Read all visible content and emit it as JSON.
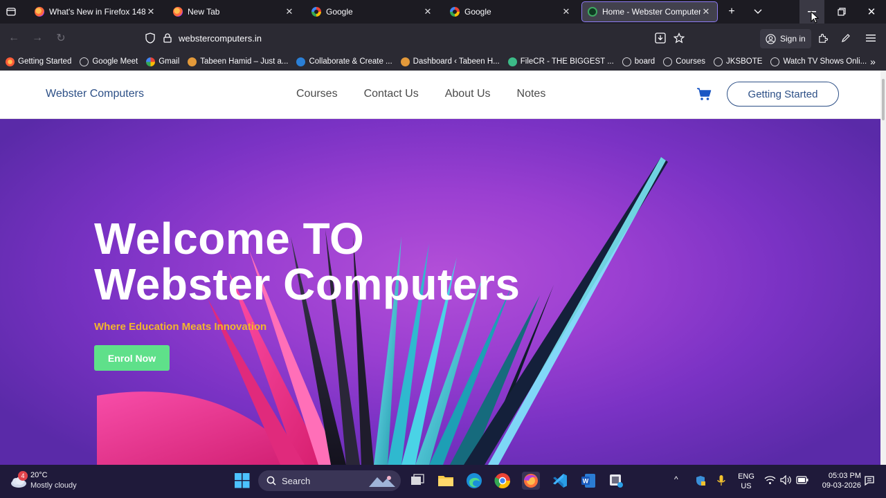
{
  "browser": {
    "tabs": [
      {
        "title": "What's New in Firefox 148",
        "favicon": "firefox-icon"
      },
      {
        "title": "New Tab",
        "favicon": "firefox-icon"
      },
      {
        "title": "Google",
        "favicon": "google-icon"
      },
      {
        "title": "Google",
        "favicon": "google-icon"
      },
      {
        "title": "Home - Webster Computers",
        "favicon": "site-icon",
        "active": true
      }
    ],
    "url": "webstercomputers.in",
    "sign_in_label": "Sign in",
    "bookmarks": [
      "Getting Started",
      "Google Meet",
      "Gmail",
      "Tabeen Hamid – Just a...",
      "Collaborate & Create ...",
      "Dashboard ‹ Tabeen H...",
      "FileCR - THE BIGGEST ...",
      "board",
      "Courses",
      "JKSBOTE",
      "Watch TV Shows Onli..."
    ]
  },
  "site": {
    "brand": "Webster Computers",
    "nav": [
      "Courses",
      "Contact Us",
      "About Us",
      "Notes"
    ],
    "cta_label": "Getting Started",
    "hero": {
      "title_line1": "Welcome TO",
      "title_line2": "Webster Computers",
      "subtitle": "Where Education Meats Innovation",
      "button_label": "Enrol Now"
    }
  },
  "taskbar": {
    "weather_temp": "20°C",
    "weather_desc": "Mostly cloudy",
    "weather_badge": "4",
    "search_label": "Search",
    "lang_top": "ENG",
    "lang_bottom": "US",
    "time": "05:03 PM",
    "date": "09-03-2026"
  },
  "colors": {
    "brand": "#2c4f86",
    "subtitle": "#f3b62c",
    "enrol_button": "#5fe08a",
    "hero_purple": "#9a3fd1",
    "taskbar": "#1f1a3a"
  }
}
